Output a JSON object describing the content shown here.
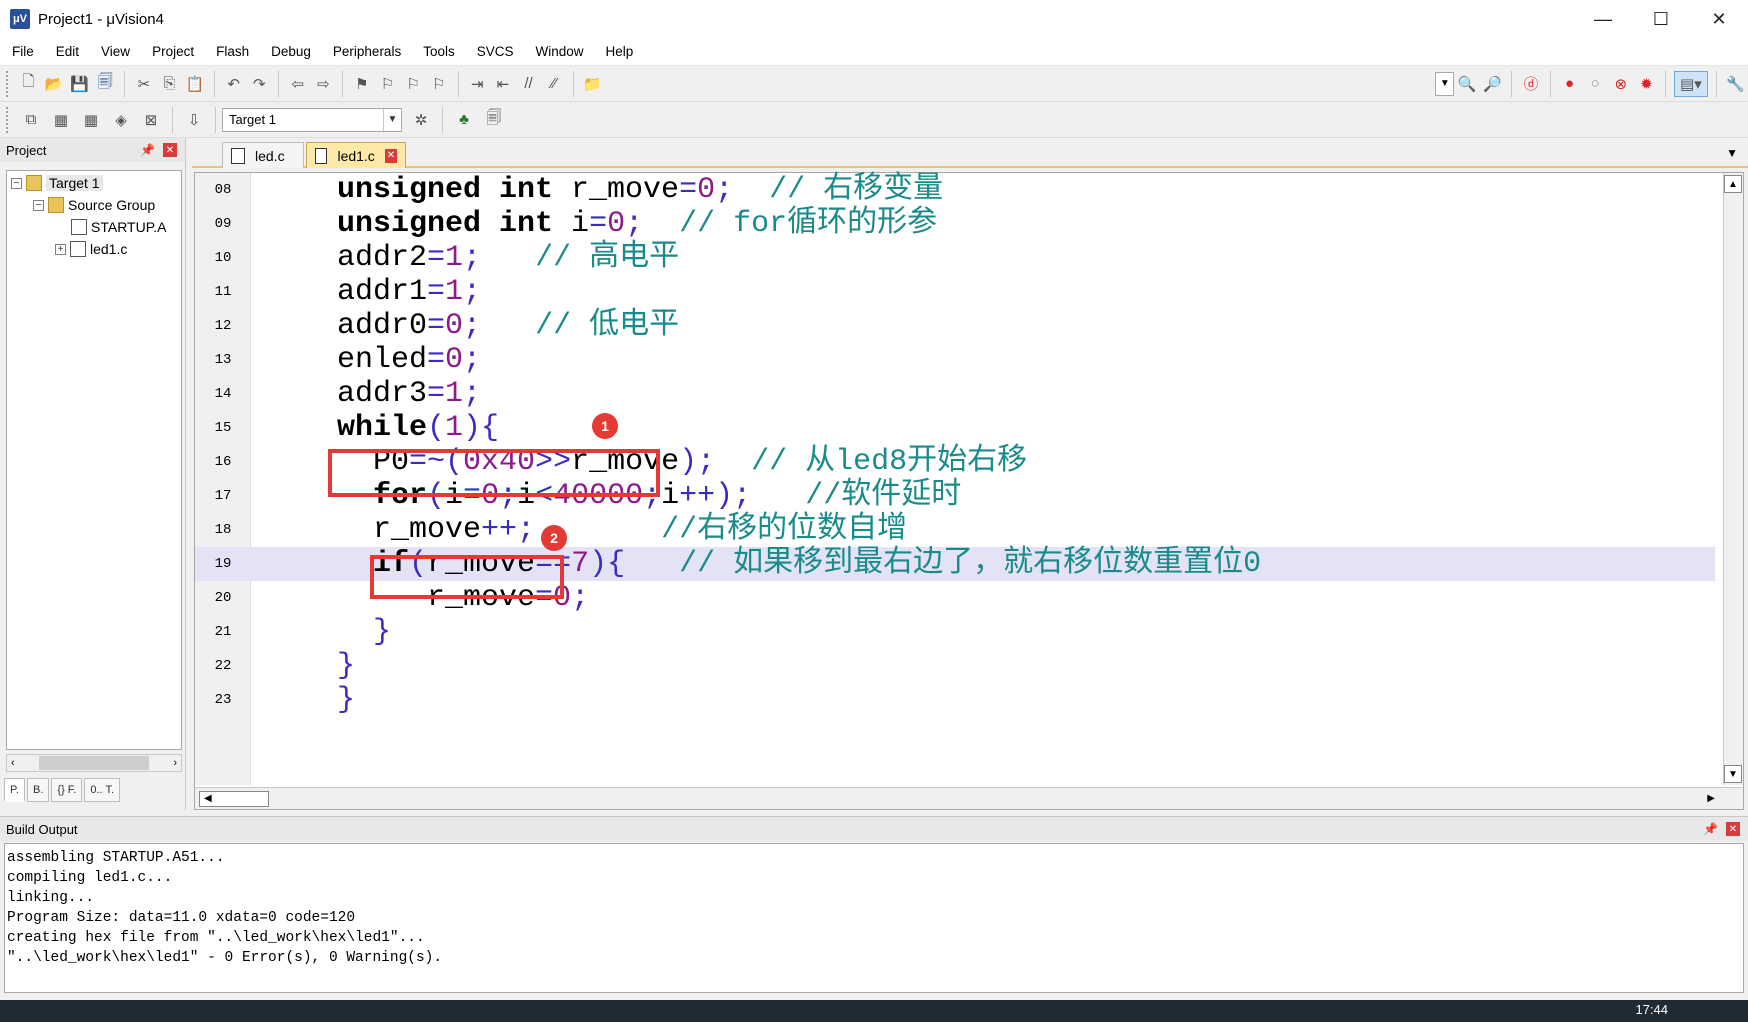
{
  "window": {
    "title": "Project1 - μVision4",
    "icon_text": "μV",
    "minimize": "—",
    "maximize": "☐",
    "close": "✕"
  },
  "menu": [
    "File",
    "Edit",
    "View",
    "Project",
    "Flash",
    "Debug",
    "Peripherals",
    "Tools",
    "SVCS",
    "Window",
    "Help"
  ],
  "toolbar2": {
    "target_select_value": "Target 1"
  },
  "project_panel": {
    "title": "Project",
    "tree": {
      "target": "Target 1",
      "group": "Source Group",
      "file1": "STARTUP.A",
      "file2": "led1.c"
    },
    "tabs": [
      "P.",
      "B.",
      "{} F.",
      "0.. T."
    ]
  },
  "editor": {
    "tabs": [
      {
        "label": "led.c"
      },
      {
        "label": "led1.c"
      }
    ],
    "current_line": "19",
    "lines": [
      {
        "n": "08",
        "parts": [
          [
            "kw",
            "unsigned int "
          ],
          [
            "",
            "r_move"
          ],
          [
            "op",
            "="
          ],
          [
            "num",
            "0"
          ],
          [
            "op",
            ";"
          ],
          [
            "",
            "  "
          ],
          [
            "cmt",
            "// 右移变量"
          ]
        ],
        "indent": 4
      },
      {
        "n": "09",
        "parts": [
          [
            "kw",
            "unsigned int "
          ],
          [
            "",
            "i"
          ],
          [
            "op",
            "="
          ],
          [
            "num",
            "0"
          ],
          [
            "op",
            ";"
          ],
          [
            "",
            "  "
          ],
          [
            "cmt",
            "// for循环的形参"
          ]
        ],
        "indent": 4
      },
      {
        "n": "10",
        "parts": [
          [
            "",
            "addr2"
          ],
          [
            "op",
            "="
          ],
          [
            "num",
            "1"
          ],
          [
            "op",
            ";"
          ],
          [
            "",
            "   "
          ],
          [
            "cmt",
            "// 高电平"
          ]
        ],
        "indent": 4
      },
      {
        "n": "11",
        "parts": [
          [
            "",
            "addr1"
          ],
          [
            "op",
            "="
          ],
          [
            "num",
            "1"
          ],
          [
            "op",
            ";"
          ]
        ],
        "indent": 4
      },
      {
        "n": "12",
        "parts": [
          [
            "",
            "addr0"
          ],
          [
            "op",
            "="
          ],
          [
            "num",
            "0"
          ],
          [
            "op",
            ";"
          ],
          [
            "",
            "   "
          ],
          [
            "cmt",
            "// 低电平"
          ]
        ],
        "indent": 4
      },
      {
        "n": "13",
        "parts": [
          [
            "",
            "enled"
          ],
          [
            "op",
            "="
          ],
          [
            "num",
            "0"
          ],
          [
            "op",
            ";"
          ]
        ],
        "indent": 4
      },
      {
        "n": "14",
        "parts": [
          [
            "",
            "addr3"
          ],
          [
            "op",
            "="
          ],
          [
            "num",
            "1"
          ],
          [
            "op",
            ";"
          ]
        ],
        "indent": 4
      },
      {
        "n": "15",
        "parts": [
          [
            "kw",
            "while"
          ],
          [
            "op",
            "("
          ],
          [
            "num",
            "1"
          ],
          [
            "op",
            "){"
          ]
        ],
        "indent": 4
      },
      {
        "n": "16",
        "parts": [
          [
            "",
            "P0"
          ],
          [
            "op",
            "=~("
          ],
          [
            "num",
            "0x40"
          ],
          [
            "op",
            ">>"
          ],
          [
            "",
            "r_move"
          ],
          [
            "op",
            ")"
          ],
          [
            "op",
            ";"
          ],
          [
            "",
            "  "
          ],
          [
            "cmt",
            "// 从led8开始右移"
          ]
        ],
        "indent": 6
      },
      {
        "n": "17",
        "parts": [
          [
            "kw",
            "for"
          ],
          [
            "op",
            "("
          ],
          [
            "",
            "i"
          ],
          [
            "op",
            "="
          ],
          [
            "num",
            "0"
          ],
          [
            "op",
            ";"
          ],
          [
            "",
            "i"
          ],
          [
            "op",
            "<"
          ],
          [
            "num",
            "40000"
          ],
          [
            "op",
            ";"
          ],
          [
            "",
            "i"
          ],
          [
            "op",
            "++);"
          ],
          [
            "",
            "   "
          ],
          [
            "cmt",
            "//软件延时"
          ]
        ],
        "indent": 6
      },
      {
        "n": "18",
        "parts": [
          [
            "",
            "r_move"
          ],
          [
            "op",
            "++;"
          ],
          [
            "",
            "       "
          ],
          [
            "cmt",
            "//右移的位数自增"
          ]
        ],
        "indent": 6
      },
      {
        "n": "19",
        "parts": [
          [
            "kw",
            "if"
          ],
          [
            "op",
            "("
          ],
          [
            "",
            "r_move"
          ],
          [
            "op",
            "=="
          ],
          [
            "num",
            "7"
          ],
          [
            "op",
            ")"
          ],
          [
            "op",
            "{"
          ],
          [
            "",
            "   "
          ],
          [
            "cmt",
            "// 如果移到最右边了，就右移位数重置位0"
          ]
        ],
        "indent": 6
      },
      {
        "n": "20",
        "parts": [
          [
            "",
            "r_move"
          ],
          [
            "op",
            "="
          ],
          [
            "num",
            "0"
          ],
          [
            "op",
            ";"
          ]
        ],
        "indent": 9
      },
      {
        "n": "21",
        "parts": [
          [
            "op",
            "}"
          ]
        ],
        "indent": 6
      },
      {
        "n": "22",
        "parts": [
          [
            "op",
            "}"
          ]
        ],
        "indent": 4
      },
      {
        "n": "23",
        "parts": [
          [
            "op",
            "}"
          ]
        ],
        "indent": 4
      }
    ],
    "annotations": [
      {
        "label": "1"
      },
      {
        "label": "2"
      }
    ]
  },
  "output": {
    "title": "Build Output",
    "lines": [
      "assembling STARTUP.A51...",
      "compiling led1.c...",
      "linking...",
      "Program Size: data=11.0 xdata=0 code=120",
      "creating hex file from \"..\\led_work\\hex\\led1\"...",
      "\"..\\led_work\\hex\\led1\" - 0 Error(s), 0 Warning(s)."
    ]
  },
  "taskbar": {
    "clock": "17:44"
  }
}
